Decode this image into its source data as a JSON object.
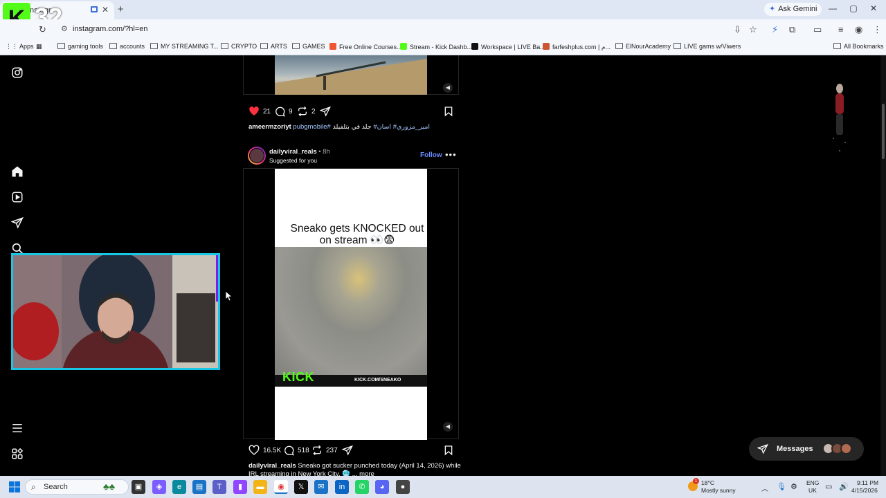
{
  "browser": {
    "tab_title": "Instagr",
    "tab_close": "✕",
    "new_tab": "+",
    "ask_gemini": "Ask Gemini",
    "url": "instagram.com/?hl=en",
    "window_controls": [
      "—",
      "▢",
      "✕"
    ]
  },
  "stream_overlay": {
    "badge_letter": "K",
    "counter": "32"
  },
  "bookmarks": {
    "apps": "Apps",
    "items": [
      "gaming tools",
      "accounts",
      "MY STREAMING T...",
      "CRYPTO",
      "ARTS",
      "GAMES",
      "Free Online Courses...",
      "Stream - Kick Dashb...",
      "Workspace | LIVE Ba...",
      "farfeshplus.com | م...",
      "ElNourAcademy",
      "LIVE gams w/Viwers"
    ],
    "all_bookmarks": "All Bookmarks"
  },
  "post1": {
    "likes": "21",
    "comments": "9",
    "reposts": "2",
    "caption_user": "ameermzoriyt",
    "caption_tags": "pubgmobile# امير_مزوري# اسان#",
    "caption_text": "جلد في بتلفيلد"
  },
  "post2": {
    "username": "dailyviral_reals",
    "time": " • 8h",
    "subtitle": "Suggested for you",
    "follow": "Follow",
    "more": "•••",
    "overlay_title": "Sneako gets KNOCKED out on stream 👀😨",
    "kick_logo": "KICK",
    "kick_url": "KICK.COM/SNEAKO",
    "likes": "16.5K",
    "comments": "518",
    "reposts": "237",
    "caption_user": "dailyviral_reals",
    "caption_text": "Sneako got sucker punched today (April 14, 2026) while",
    "caption_line2": "IRL streaming in New York City. 🥶 ... more"
  },
  "messages": {
    "label": "Messages"
  },
  "taskbar": {
    "search": "Search",
    "weather_temp": "18°C",
    "weather_desc": "Mostly sunny",
    "weather_badge": "1",
    "lang1": "ENG",
    "lang2": "UK",
    "time": "9:11 PM",
    "date": "4/15/2026"
  },
  "colors": {
    "kick_green": "#53fc18",
    "instagram_link": "#6b8cff",
    "like_red": "#ff3040",
    "webcam_border": "#18c7e6",
    "webcam_accent": "#7a1fe8"
  }
}
